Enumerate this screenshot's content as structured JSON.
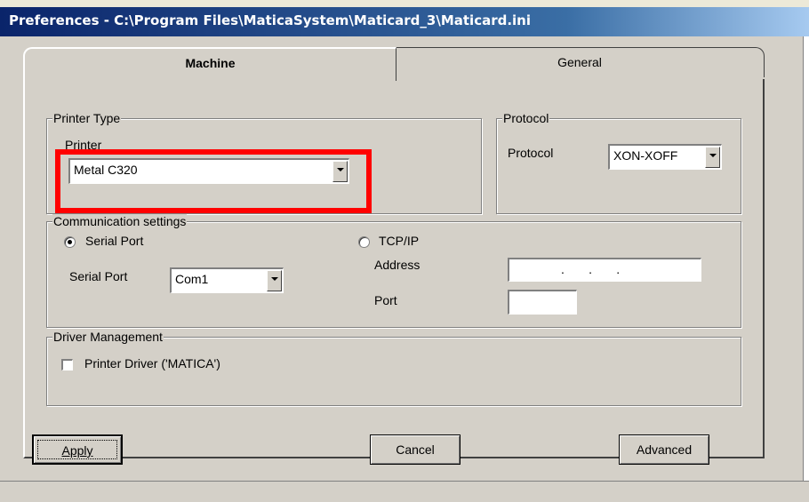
{
  "window": {
    "title": "Preferences - C:\\Program Files\\MaticaSystem\\Maticard_3\\Maticard.ini"
  },
  "tabs": [
    {
      "label": "Machine",
      "active": true
    },
    {
      "label": "General",
      "active": false
    }
  ],
  "printer_type": {
    "legend": "Printer Type",
    "printer_label": "Printer",
    "printer_value": "Metal C320"
  },
  "protocol": {
    "legend": "Protocol",
    "protocol_label": "Protocol",
    "protocol_value": "XON-XOFF"
  },
  "communication": {
    "legend": "Communication settings",
    "serial_radio_label": "Serial Port",
    "serial_selected": true,
    "tcp_radio_label": "TCP/IP",
    "serial_port_label": "Serial Port",
    "serial_port_value": "Com1",
    "address_label": "Address",
    "address_value": ".       .       .",
    "port_label": "Port",
    "port_value": ""
  },
  "driver": {
    "legend": "Driver Management",
    "checkbox_label": "Printer Driver ('MATICA')",
    "checked": false
  },
  "buttons": {
    "apply": "Apply",
    "cancel": "Cancel",
    "advanced": "Advanced"
  },
  "colors": {
    "highlight_box": "#ff0000",
    "title_bar": "#0a246a"
  }
}
